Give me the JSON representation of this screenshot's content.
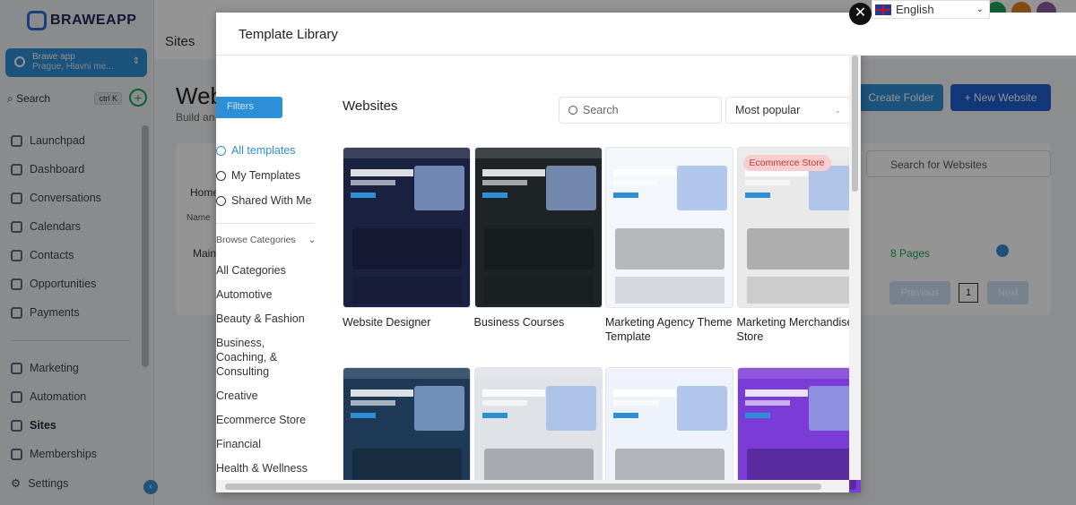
{
  "app": {
    "logo_text": "BRAWEAPP",
    "account": {
      "name": "Brawe app",
      "location": "Prague, Hlavni me..."
    },
    "search": {
      "label": "Search",
      "shortcut": "ctrl K"
    },
    "nav": [
      {
        "label": "Launchpad",
        "icon": "rocket-icon"
      },
      {
        "label": "Dashboard",
        "icon": "grid-icon"
      },
      {
        "label": "Conversations",
        "icon": "chat-icon"
      },
      {
        "label": "Calendars",
        "icon": "calendar-icon"
      },
      {
        "label": "Contacts",
        "icon": "contacts-icon"
      },
      {
        "label": "Opportunities",
        "icon": "opportunities-icon"
      },
      {
        "label": "Payments",
        "icon": "payments-icon"
      }
    ],
    "nav2": [
      {
        "label": "Marketing",
        "icon": "send-icon"
      },
      {
        "label": "Automation",
        "icon": "automation-icon"
      },
      {
        "label": "Sites",
        "icon": "sites-icon"
      },
      {
        "label": "Memberships",
        "icon": "memberships-icon"
      }
    ],
    "settings_label": "Settings",
    "top_tab": "Sites",
    "page_title": "Web",
    "page_subtitle": "Build an",
    "create_folder": "Create Folder",
    "new_website": "+ New Website",
    "search_websites": "Search for Websites",
    "home_label": "Home",
    "name_col": "Name",
    "main_row": "Main",
    "pages_count": "8 Pages",
    "prev": "Previous",
    "page_num": "1",
    "next": "Next"
  },
  "language": {
    "label": "English"
  },
  "modal": {
    "title": "Template Library",
    "filters_label": "Filters",
    "section_title": "Websites",
    "search_placeholder": "Search",
    "sort_value": "Most popular",
    "left_nav": [
      {
        "label": "All templates",
        "icon": "check-circle-icon"
      },
      {
        "label": "My Templates",
        "icon": "user-icon"
      },
      {
        "label": "Shared With Me",
        "icon": "share-icon"
      }
    ],
    "browse_categories": "Browse Categories",
    "categories": [
      "All Categories",
      "Automotive",
      "Beauty & Fashion",
      "Business, Coaching, & Consulting",
      "Creative",
      "Ecommerce Store",
      "Financial",
      "Health & Wellness"
    ],
    "templates": [
      {
        "title": "Website Designer",
        "bg": "#1b2140"
      },
      {
        "title": "Business Courses",
        "bg": "#1e2426"
      },
      {
        "title": "Marketing Agency Theme Template",
        "bg": "#f3f6fb"
      },
      {
        "title": "Marketing Merchandise Store",
        "bg": "#e9e9e9",
        "badge": "Ecommerce Store"
      },
      {
        "title": "",
        "bg": "#1f3a57"
      },
      {
        "title": "",
        "bg": "#dfe3e8"
      },
      {
        "title": "",
        "bg": "#eef3f9"
      },
      {
        "title": "",
        "bg": "#7a3bd6"
      }
    ]
  }
}
